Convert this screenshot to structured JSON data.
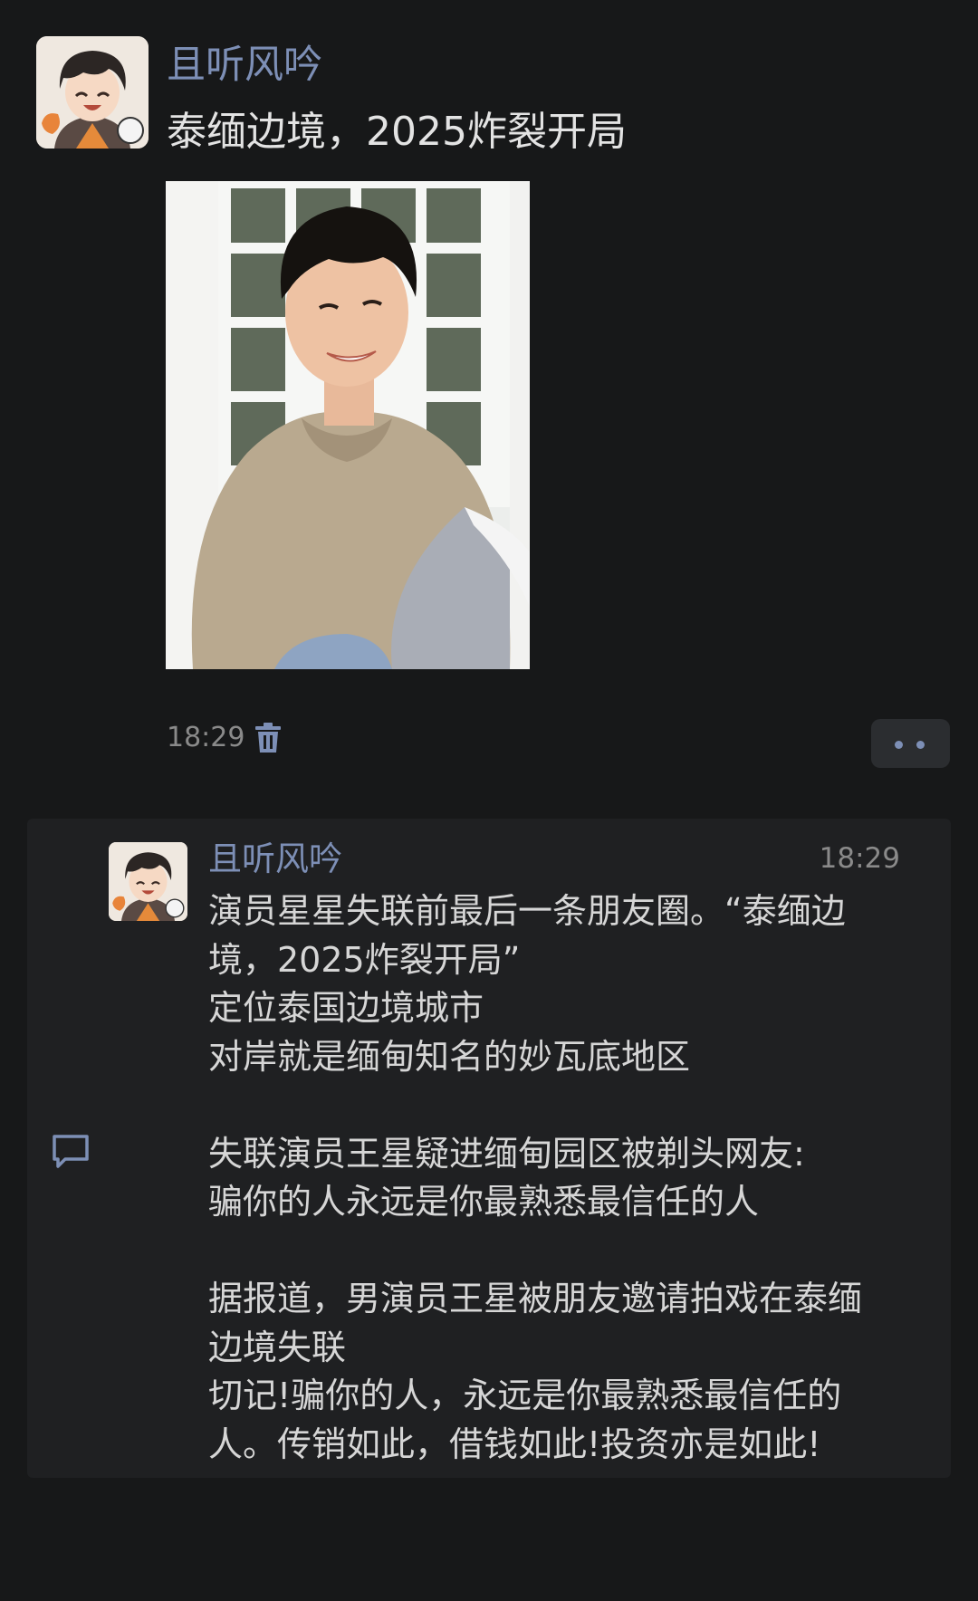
{
  "post": {
    "author": "且听风吟",
    "text": "泰缅边境，2025炸裂开局",
    "time": "18:29"
  },
  "comment": {
    "author": "且听风吟",
    "time": "18:29",
    "lines": [
      "演员星星失联前最后一条朋友圈。“泰缅边",
      "境，2025炸裂开局”",
      "定位泰国边境城市",
      "对岸就是缅甸知名的妙瓦底地区",
      "",
      "失联演员王星疑进缅甸园区被剃头网友:",
      "骗你的人永远是你最熟悉最信任的人",
      "",
      "据报道，男演员王星被朋友邀请拍戏在泰缅",
      "边境失联",
      "切记!骗你的人，永远是你最熟悉最信任的",
      "人。传销如此，借钱如此!投资亦是如此!"
    ]
  },
  "icons": {
    "delete": "trash-icon",
    "more": "more-dots-icon",
    "comment": "comment-bubble-icon"
  },
  "colors": {
    "background": "#171819",
    "accent": "#7d8fb6",
    "panel": "#1f2022"
  }
}
